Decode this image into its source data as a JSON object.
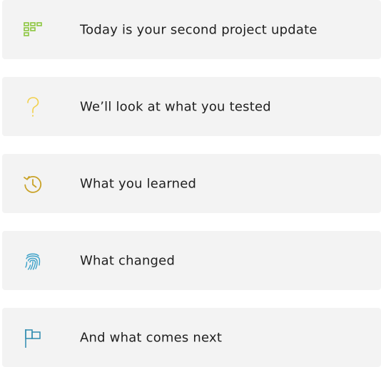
{
  "colors": {
    "card_background": "#f3f3f3",
    "text": "#1f1f1f",
    "grid_icon": "#8cc63f",
    "question_icon": "#f2d04a",
    "history_icon": "#c9a227",
    "fingerprint_icon": "#3aa0c8",
    "flag_icon": "#2e8bb0"
  },
  "items": [
    {
      "icon": "grid-icon",
      "label": "Today is your second project update"
    },
    {
      "icon": "question-mark-icon",
      "label": "We’ll look at what you tested"
    },
    {
      "icon": "history-icon",
      "label": "What you learned"
    },
    {
      "icon": "fingerprint-icon",
      "label": "What changed"
    },
    {
      "icon": "flag-icon",
      "label": "And what comes next"
    }
  ]
}
